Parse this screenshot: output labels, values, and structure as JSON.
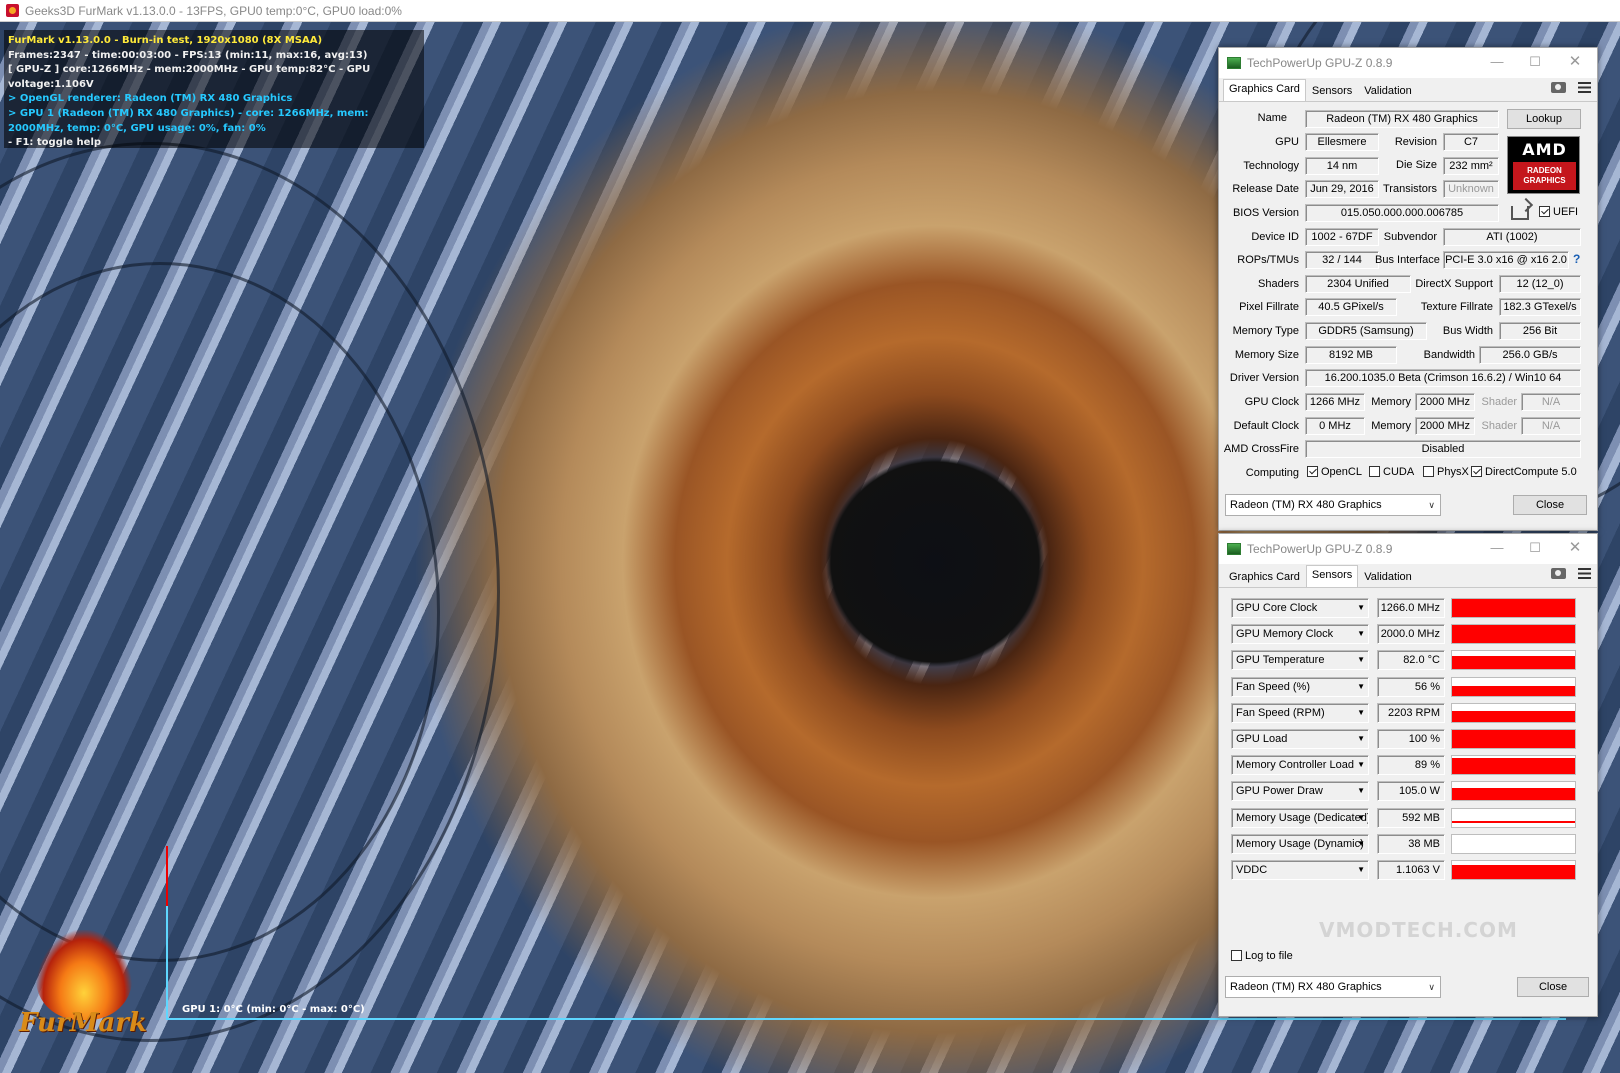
{
  "furmark": {
    "window_title": "Geeks3D FurMark v1.13.0.0 - 13FPS, GPU0 temp:0°C, GPU0 load:0%",
    "hud": {
      "line1": "FurMark v1.13.0.0 - Burn-in test, 1920x1080 (8X MSAA)",
      "line2": "Frames:2347 - time:00:03:00 - FPS:13 (min:11, max:16, avg:13)",
      "line3": "[ GPU-Z ] core:1266MHz - mem:2000MHz - GPU temp:82°C - GPU voltage:1.106V",
      "line4": "> OpenGL renderer: Radeon (TM) RX 480 Graphics",
      "line5": "> GPU 1 (Radeon (TM) RX 480 Graphics) - core: 1266MHz, mem: 2000MHz, temp: 0°C, GPU usage: 0%, fan: 0%",
      "line6": "- F1: toggle help"
    },
    "graph_label": "GPU 1: 0°C (min: 0°C - max: 0°C)",
    "logo_text": "FurMark"
  },
  "gpuz_main": {
    "title": "TechPowerUp GPU-Z 0.8.9",
    "tabs": [
      "Graphics Card",
      "Sensors",
      "Validation"
    ],
    "labels": {
      "name": "Name",
      "gpu": "GPU",
      "revision": "Revision",
      "technology": "Technology",
      "die_size": "Die Size",
      "release_date": "Release Date",
      "transistors": "Transistors",
      "bios_version": "BIOS Version",
      "device_id": "Device ID",
      "subvendor": "Subvendor",
      "rops_tmus": "ROPs/TMUs",
      "bus_interface": "Bus Interface",
      "shaders": "Shaders",
      "directx_support": "DirectX Support",
      "pixel_fillrate": "Pixel Fillrate",
      "texture_fillrate": "Texture Fillrate",
      "memory_type": "Memory Type",
      "bus_width": "Bus Width",
      "memory_size": "Memory Size",
      "bandwidth": "Bandwidth",
      "driver_version": "Driver Version",
      "gpu_clock": "GPU Clock",
      "memory": "Memory",
      "shader": "Shader",
      "default_clock": "Default Clock",
      "amd_crossfire": "AMD CrossFire",
      "computing": "Computing"
    },
    "values": {
      "name": "Radeon (TM) RX 480 Graphics",
      "gpu": "Ellesmere",
      "revision": "C7",
      "technology": "14 nm",
      "die_size": "232 mm²",
      "release_date": "Jun 29, 2016",
      "transistors": "Unknown",
      "bios_version": "015.050.000.000.006785",
      "uefi": "UEFI",
      "device_id": "1002 - 67DF",
      "subvendor": "ATI (1002)",
      "rops_tmus": "32 / 144",
      "bus_interface": "PCI-E 3.0 x16 @ x16 2.0",
      "shaders": "2304 Unified",
      "directx_support": "12 (12_0)",
      "pixel_fillrate": "40.5 GPixel/s",
      "texture_fillrate": "182.3 GTexel/s",
      "memory_type": "GDDR5 (Samsung)",
      "bus_width": "256 Bit",
      "memory_size": "8192 MB",
      "bandwidth": "256.0 GB/s",
      "driver_version": "16.200.1035.0 Beta (Crimson 16.6.2) / Win10 64",
      "gpu_clock": "1266 MHz",
      "gpu_clock_memory": "2000 MHz",
      "gpu_clock_shader": "N/A",
      "default_clock": "0 MHz",
      "default_clock_memory": "2000 MHz",
      "default_clock_shader": "N/A",
      "amd_crossfire": "Disabled"
    },
    "computing": [
      {
        "label": "OpenCL",
        "checked": true
      },
      {
        "label": "CUDA",
        "checked": false
      },
      {
        "label": "PhysX",
        "checked": false
      },
      {
        "label": "DirectCompute 5.0",
        "checked": true
      }
    ],
    "lookup_label": "Lookup",
    "amd_logo": {
      "brand": "AMD",
      "sub1": "RADEON",
      "sub2": "GRAPHICS"
    },
    "gpu_select": "Radeon (TM) RX 480 Graphics",
    "close_label": "Close"
  },
  "gpuz_sensors": {
    "title": "TechPowerUp GPU-Z 0.8.9",
    "tabs": [
      "Graphics Card",
      "Sensors",
      "Validation"
    ],
    "sensors": [
      {
        "name": "GPU Core Clock",
        "value": "1266.0 MHz",
        "level": 1.0
      },
      {
        "name": "GPU Memory Clock",
        "value": "2000.0 MHz",
        "level": 1.0
      },
      {
        "name": "GPU Temperature",
        "value": "82.0 °C",
        "level": 0.75
      },
      {
        "name": "Fan Speed (%)",
        "value": "56 %",
        "level": 0.56
      },
      {
        "name": "Fan Speed (RPM)",
        "value": "2203 RPM",
        "level": 0.6
      },
      {
        "name": "GPU Load",
        "value": "100 %",
        "level": 1.0
      },
      {
        "name": "Memory Controller Load",
        "value": "89 %",
        "level": 0.89
      },
      {
        "name": "GPU Power Draw",
        "value": "105.0 W",
        "level": 0.7
      },
      {
        "name": "Memory Usage (Dedicated)",
        "value": "592 MB",
        "level": 0.07
      },
      {
        "name": "Memory Usage (Dynamic)",
        "value": "38 MB",
        "level": 0.0
      },
      {
        "name": "VDDC",
        "value": "1.1063 V",
        "level": 0.8
      }
    ],
    "log_to_file": "Log to file",
    "gpu_select": "Radeon (TM) RX 480 Graphics",
    "close_label": "Close",
    "watermark": "VMODTECH.COM"
  }
}
